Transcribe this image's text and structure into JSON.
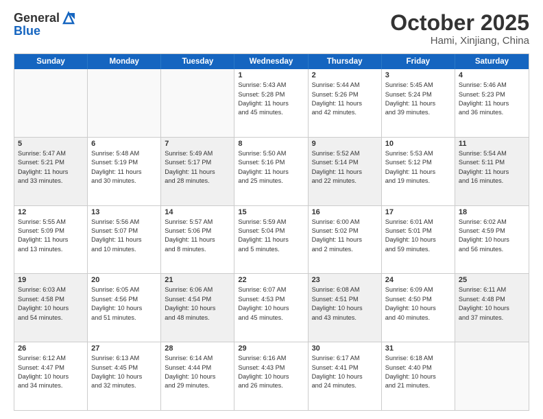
{
  "header": {
    "logo_general": "General",
    "logo_blue": "Blue",
    "month_title": "October 2025",
    "location": "Hami, Xinjiang, China"
  },
  "day_headers": [
    "Sunday",
    "Monday",
    "Tuesday",
    "Wednesday",
    "Thursday",
    "Friday",
    "Saturday"
  ],
  "weeks": [
    {
      "shaded": [
        false,
        false,
        false,
        false,
        false,
        false,
        false
      ],
      "days": [
        {
          "num": "",
          "info": ""
        },
        {
          "num": "",
          "info": ""
        },
        {
          "num": "",
          "info": ""
        },
        {
          "num": "1",
          "info": "Sunrise: 5:43 AM\nSunset: 5:28 PM\nDaylight: 11 hours\nand 45 minutes."
        },
        {
          "num": "2",
          "info": "Sunrise: 5:44 AM\nSunset: 5:26 PM\nDaylight: 11 hours\nand 42 minutes."
        },
        {
          "num": "3",
          "info": "Sunrise: 5:45 AM\nSunset: 5:24 PM\nDaylight: 11 hours\nand 39 minutes."
        },
        {
          "num": "4",
          "info": "Sunrise: 5:46 AM\nSunset: 5:23 PM\nDaylight: 11 hours\nand 36 minutes."
        }
      ]
    },
    {
      "shaded": [
        true,
        false,
        true,
        false,
        true,
        false,
        true
      ],
      "days": [
        {
          "num": "5",
          "info": "Sunrise: 5:47 AM\nSunset: 5:21 PM\nDaylight: 11 hours\nand 33 minutes."
        },
        {
          "num": "6",
          "info": "Sunrise: 5:48 AM\nSunset: 5:19 PM\nDaylight: 11 hours\nand 30 minutes."
        },
        {
          "num": "7",
          "info": "Sunrise: 5:49 AM\nSunset: 5:17 PM\nDaylight: 11 hours\nand 28 minutes."
        },
        {
          "num": "8",
          "info": "Sunrise: 5:50 AM\nSunset: 5:16 PM\nDaylight: 11 hours\nand 25 minutes."
        },
        {
          "num": "9",
          "info": "Sunrise: 5:52 AM\nSunset: 5:14 PM\nDaylight: 11 hours\nand 22 minutes."
        },
        {
          "num": "10",
          "info": "Sunrise: 5:53 AM\nSunset: 5:12 PM\nDaylight: 11 hours\nand 19 minutes."
        },
        {
          "num": "11",
          "info": "Sunrise: 5:54 AM\nSunset: 5:11 PM\nDaylight: 11 hours\nand 16 minutes."
        }
      ]
    },
    {
      "shaded": [
        false,
        false,
        false,
        false,
        false,
        false,
        false
      ],
      "days": [
        {
          "num": "12",
          "info": "Sunrise: 5:55 AM\nSunset: 5:09 PM\nDaylight: 11 hours\nand 13 minutes."
        },
        {
          "num": "13",
          "info": "Sunrise: 5:56 AM\nSunset: 5:07 PM\nDaylight: 11 hours\nand 10 minutes."
        },
        {
          "num": "14",
          "info": "Sunrise: 5:57 AM\nSunset: 5:06 PM\nDaylight: 11 hours\nand 8 minutes."
        },
        {
          "num": "15",
          "info": "Sunrise: 5:59 AM\nSunset: 5:04 PM\nDaylight: 11 hours\nand 5 minutes."
        },
        {
          "num": "16",
          "info": "Sunrise: 6:00 AM\nSunset: 5:02 PM\nDaylight: 11 hours\nand 2 minutes."
        },
        {
          "num": "17",
          "info": "Sunrise: 6:01 AM\nSunset: 5:01 PM\nDaylight: 10 hours\nand 59 minutes."
        },
        {
          "num": "18",
          "info": "Sunrise: 6:02 AM\nSunset: 4:59 PM\nDaylight: 10 hours\nand 56 minutes."
        }
      ]
    },
    {
      "shaded": [
        true,
        false,
        true,
        false,
        true,
        false,
        true
      ],
      "days": [
        {
          "num": "19",
          "info": "Sunrise: 6:03 AM\nSunset: 4:58 PM\nDaylight: 10 hours\nand 54 minutes."
        },
        {
          "num": "20",
          "info": "Sunrise: 6:05 AM\nSunset: 4:56 PM\nDaylight: 10 hours\nand 51 minutes."
        },
        {
          "num": "21",
          "info": "Sunrise: 6:06 AM\nSunset: 4:54 PM\nDaylight: 10 hours\nand 48 minutes."
        },
        {
          "num": "22",
          "info": "Sunrise: 6:07 AM\nSunset: 4:53 PM\nDaylight: 10 hours\nand 45 minutes."
        },
        {
          "num": "23",
          "info": "Sunrise: 6:08 AM\nSunset: 4:51 PM\nDaylight: 10 hours\nand 43 minutes."
        },
        {
          "num": "24",
          "info": "Sunrise: 6:09 AM\nSunset: 4:50 PM\nDaylight: 10 hours\nand 40 minutes."
        },
        {
          "num": "25",
          "info": "Sunrise: 6:11 AM\nSunset: 4:48 PM\nDaylight: 10 hours\nand 37 minutes."
        }
      ]
    },
    {
      "shaded": [
        false,
        false,
        false,
        false,
        false,
        false,
        false
      ],
      "days": [
        {
          "num": "26",
          "info": "Sunrise: 6:12 AM\nSunset: 4:47 PM\nDaylight: 10 hours\nand 34 minutes."
        },
        {
          "num": "27",
          "info": "Sunrise: 6:13 AM\nSunset: 4:45 PM\nDaylight: 10 hours\nand 32 minutes."
        },
        {
          "num": "28",
          "info": "Sunrise: 6:14 AM\nSunset: 4:44 PM\nDaylight: 10 hours\nand 29 minutes."
        },
        {
          "num": "29",
          "info": "Sunrise: 6:16 AM\nSunset: 4:43 PM\nDaylight: 10 hours\nand 26 minutes."
        },
        {
          "num": "30",
          "info": "Sunrise: 6:17 AM\nSunset: 4:41 PM\nDaylight: 10 hours\nand 24 minutes."
        },
        {
          "num": "31",
          "info": "Sunrise: 6:18 AM\nSunset: 4:40 PM\nDaylight: 10 hours\nand 21 minutes."
        },
        {
          "num": "",
          "info": ""
        }
      ]
    }
  ]
}
